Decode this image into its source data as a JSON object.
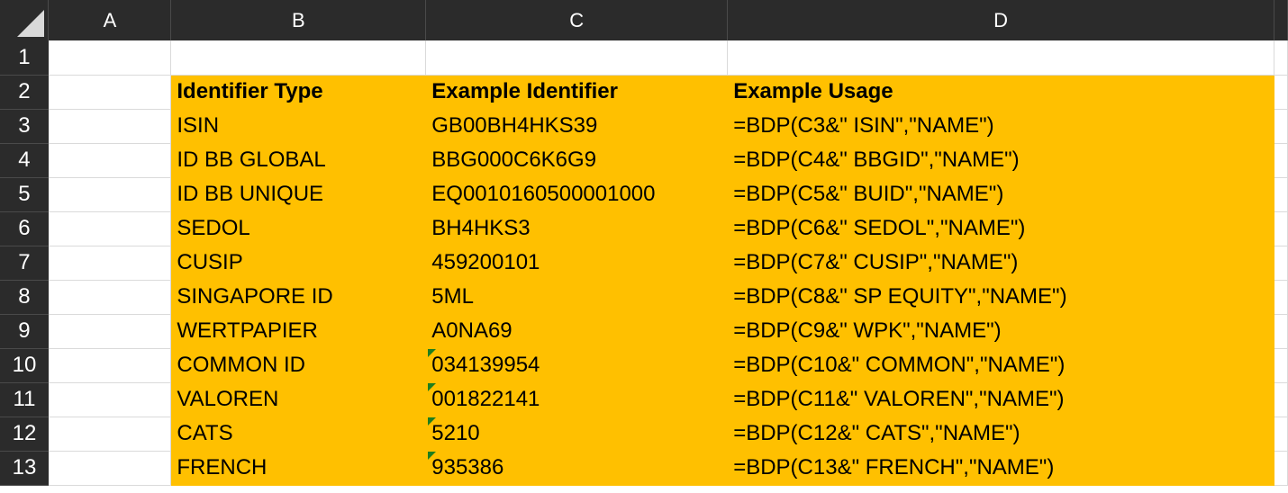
{
  "columns": [
    "A",
    "B",
    "C",
    "D"
  ],
  "rows": [
    "1",
    "2",
    "3",
    "4",
    "5",
    "6",
    "7",
    "8",
    "9",
    "10",
    "11",
    "12",
    "13"
  ],
  "header": {
    "identifier_type": "Identifier Type",
    "example_identifier": "Example Identifier",
    "example_usage": "Example Usage"
  },
  "data_rows": [
    {
      "type": "ISIN",
      "identifier": "GB00BH4HKS39",
      "usage": "=BDP(C3&\" ISIN\",\"NAME\")",
      "flag": false
    },
    {
      "type": "ID BB GLOBAL",
      "identifier": "BBG000C6K6G9",
      "usage": "=BDP(C4&\" BBGID\",\"NAME\")",
      "flag": false
    },
    {
      "type": "ID BB UNIQUE",
      "identifier": "EQ0010160500001000",
      "usage": "=BDP(C5&\" BUID\",\"NAME\")",
      "flag": false
    },
    {
      "type": "SEDOL",
      "identifier": "BH4HKS3",
      "usage": "=BDP(C6&\" SEDOL\",\"NAME\")",
      "flag": false
    },
    {
      "type": "CUSIP",
      "identifier": "459200101",
      "usage": "=BDP(C7&\" CUSIP\",\"NAME\")",
      "flag": false
    },
    {
      "type": "SINGAPORE ID",
      "identifier": "5ML",
      "usage": "=BDP(C8&\" SP EQUITY\",\"NAME\")",
      "flag": false
    },
    {
      "type": "WERTPAPIER",
      "identifier": "A0NA69",
      "usage": "=BDP(C9&\" WPK\",\"NAME\")",
      "flag": false
    },
    {
      "type": "COMMON ID",
      "identifier": "034139954",
      "usage": "=BDP(C10&\" COMMON\",\"NAME\")",
      "flag": true
    },
    {
      "type": "VALOREN",
      "identifier": "001822141",
      "usage": "=BDP(C11&\" VALOREN\",\"NAME\")",
      "flag": true
    },
    {
      "type": "CATS",
      "identifier": "5210",
      "usage": "=BDP(C12&\" CATS\",\"NAME\")",
      "flag": true
    },
    {
      "type": "FRENCH",
      "identifier": "935386",
      "usage": "=BDP(C13&\" FRENCH\",\"NAME\")",
      "flag": true
    }
  ],
  "colors": {
    "highlight_fill": "#ffc000",
    "header_bg": "#2b2b2b",
    "error_flag": "#1e7e1e"
  }
}
